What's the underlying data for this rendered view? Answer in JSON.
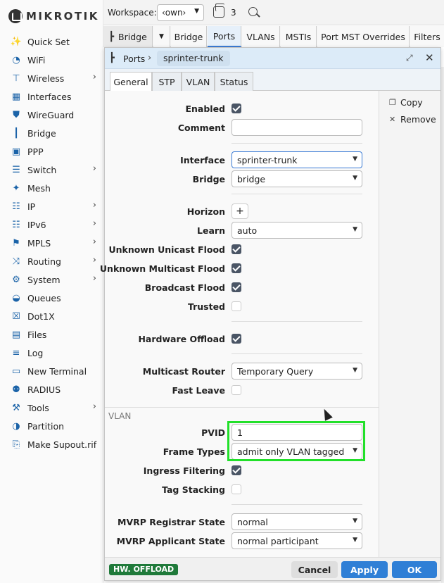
{
  "brand": "MIKROTIK",
  "sidebar": {
    "items": [
      {
        "label": "Quick Set",
        "icon": "wand-icon",
        "arrow": false
      },
      {
        "label": "WiFi",
        "icon": "wifi-icon",
        "arrow": false
      },
      {
        "label": "Wireless",
        "icon": "antenna-icon",
        "arrow": true
      },
      {
        "label": "Interfaces",
        "icon": "interfaces-icon",
        "arrow": false
      },
      {
        "label": "WireGuard",
        "icon": "shield-icon",
        "arrow": false
      },
      {
        "label": "Bridge",
        "icon": "bridge-icon",
        "arrow": false
      },
      {
        "label": "PPP",
        "icon": "ppp-icon",
        "arrow": false
      },
      {
        "label": "Switch",
        "icon": "switch-icon",
        "arrow": true
      },
      {
        "label": "Mesh",
        "icon": "mesh-icon",
        "arrow": false
      },
      {
        "label": "IP",
        "icon": "ip-icon",
        "arrow": true
      },
      {
        "label": "IPv6",
        "icon": "ipv6-icon",
        "arrow": true
      },
      {
        "label": "MPLS",
        "icon": "tag-icon",
        "arrow": true
      },
      {
        "label": "Routing",
        "icon": "routing-icon",
        "arrow": true
      },
      {
        "label": "System",
        "icon": "gear-icon",
        "arrow": true
      },
      {
        "label": "Queues",
        "icon": "queues-icon",
        "arrow": false
      },
      {
        "label": "Dot1X",
        "icon": "dot1x-icon",
        "arrow": false
      },
      {
        "label": "Files",
        "icon": "folder-icon",
        "arrow": false
      },
      {
        "label": "Log",
        "icon": "log-icon",
        "arrow": false
      },
      {
        "label": "New Terminal",
        "icon": "terminal-icon",
        "arrow": false
      },
      {
        "label": "RADIUS",
        "icon": "radius-icon",
        "arrow": false
      },
      {
        "label": "Tools",
        "icon": "tools-icon",
        "arrow": true
      },
      {
        "label": "Partition",
        "icon": "partition-icon",
        "arrow": false
      },
      {
        "label": "Make Supout.rif",
        "icon": "supout-icon",
        "arrow": false
      }
    ]
  },
  "topbar": {
    "workspace_label": "Workspace:",
    "workspace_value": "‹own›",
    "window_count": "3"
  },
  "tabstrip": {
    "section": "Bridge",
    "tabs": [
      "Bridge",
      "Ports",
      "VLANs",
      "MSTIs",
      "Port MST Overrides",
      "Filters"
    ],
    "active": "Ports"
  },
  "dialog": {
    "title": "Ports",
    "item": "sprinter-trunk",
    "tabs": [
      "General",
      "STP",
      "VLAN",
      "Status"
    ],
    "active_tab": "General",
    "actions": {
      "copy": "Copy",
      "remove": "Remove"
    },
    "fields": {
      "enabled": {
        "label": "Enabled",
        "checked": true
      },
      "comment": {
        "label": "Comment",
        "value": ""
      },
      "interface": {
        "label": "Interface",
        "value": "sprinter-trunk"
      },
      "bridge": {
        "label": "Bridge",
        "value": "bridge"
      },
      "horizon": {
        "label": "Horizon",
        "button": "+"
      },
      "learn": {
        "label": "Learn",
        "value": "auto"
      },
      "unknown_unicast_flood": {
        "label": "Unknown Unicast Flood",
        "checked": true
      },
      "unknown_multicast_flood": {
        "label": "Unknown Multicast Flood",
        "checked": true
      },
      "broadcast_flood": {
        "label": "Broadcast Flood",
        "checked": true
      },
      "trusted": {
        "label": "Trusted",
        "checked": false
      },
      "hardware_offload": {
        "label": "Hardware Offload",
        "checked": true
      },
      "multicast_router": {
        "label": "Multicast Router",
        "value": "Temporary Query"
      },
      "fast_leave": {
        "label": "Fast Leave",
        "checked": false
      }
    },
    "vlan_section": {
      "heading": "VLAN",
      "pvid": {
        "label": "PVID",
        "value": "1"
      },
      "frame_types": {
        "label": "Frame Types",
        "value": "admit only VLAN tagged"
      },
      "ingress_filtering": {
        "label": "Ingress Filtering",
        "checked": true
      },
      "tag_stacking": {
        "label": "Tag Stacking",
        "checked": false
      },
      "mvrp_registrar_state": {
        "label": "MVRP Registrar State",
        "value": "normal"
      },
      "mvrp_applicant_state": {
        "label": "MVRP Applicant State",
        "value": "normal participant"
      }
    },
    "footer": {
      "badge": "HW. OFFLOAD",
      "cancel": "Cancel",
      "apply": "Apply",
      "ok": "OK"
    }
  },
  "colors": {
    "accent": "#2f7fd6",
    "highlight": "#22e02a",
    "badge": "#1f7a3a",
    "header": "#dcebf8"
  }
}
